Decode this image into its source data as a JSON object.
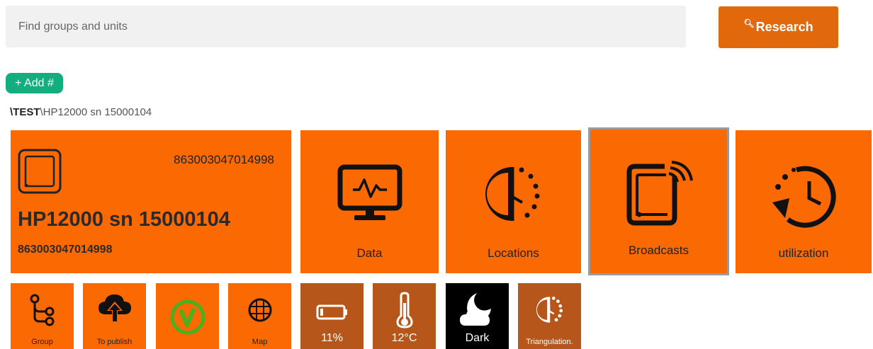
{
  "search": {
    "placeholder": "Find groups and units"
  },
  "research_button": {
    "label": "Research",
    "icon": "search-icon"
  },
  "add_button": {
    "label": "+ Add #"
  },
  "breadcrumb": {
    "root": "\\TEST",
    "current": "\\HP12000 sn 15000104"
  },
  "device": {
    "name": "HP12000 sn 15000104",
    "serial_top": "863003047014998",
    "serial_bottom": "863003047014998",
    "icon": "device-icon"
  },
  "tiles": [
    {
      "label": "Data",
      "icon": "monitor-icon"
    },
    {
      "label": "Locations",
      "icon": "clock-dots-icon"
    },
    {
      "label": "Broadcasts",
      "icon": "broadcast-icon"
    },
    {
      "label": "utilization",
      "icon": "history-icon"
    }
  ],
  "small_tiles": [
    {
      "label": "Group",
      "icon": "group-tree-icon"
    },
    {
      "label": "To publish",
      "icon": "cloud-upload-icon"
    },
    {
      "label": "",
      "icon": "check-circle-icon"
    },
    {
      "label": "Map",
      "icon": "globe-icon"
    },
    {
      "label": "11%",
      "icon": "battery-icon"
    },
    {
      "label": "12°C",
      "icon": "thermometer-icon"
    },
    {
      "label": "Dark",
      "icon": "moon-cloud-icon"
    },
    {
      "label": "Triangulation.",
      "icon": "clock-dots-icon"
    }
  ],
  "colors": {
    "orange": "#fb6902",
    "button": "#e1690c",
    "add": "#14ad80",
    "dark_tile": "#b6561b",
    "check": "#4caf1d"
  }
}
